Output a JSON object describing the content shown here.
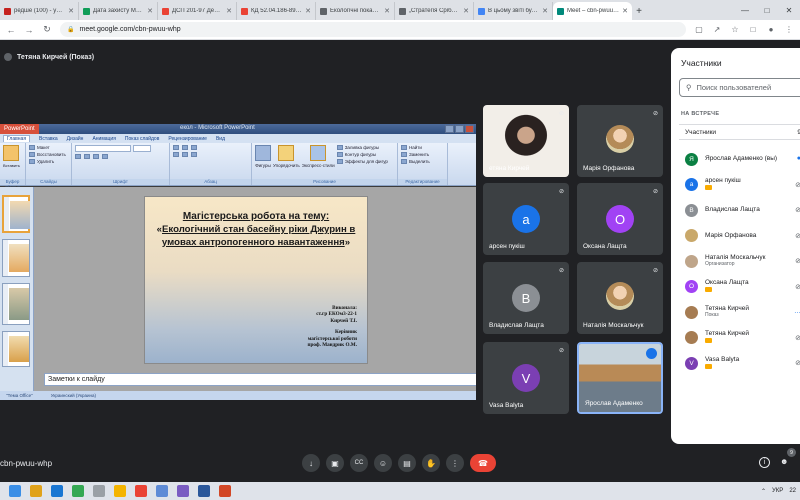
{
  "browser": {
    "tabs": [
      {
        "title": "редше (100) - yarad.Il",
        "color": "#c5221f",
        "active": false
      },
      {
        "title": "Дата захисту МР - Босг",
        "color": "#0f9d58",
        "active": false
      },
      {
        "title": "ДСП 201-97 Державні с",
        "color": "#ea4335",
        "active": false
      },
      {
        "title": "КД 52.04.186-89 Руково",
        "color": "#ea4335",
        "active": false
      },
      {
        "title": "Екологічні показники - И",
        "color": "#5f6368",
        "active": false
      },
      {
        "title": "„Стратегія Срібнянсько",
        "color": "#5f6368",
        "active": false
      },
      {
        "title": "В цьому звіті було проа",
        "color": "#4285f4",
        "active": false
      },
      {
        "title": "Meet – cbn-pwuu-whp",
        "color": "#00897b",
        "active": true
      }
    ],
    "new_tab": "+",
    "url": "meet.google.com/cbn-pwuu-whp"
  },
  "meet": {
    "presenter_label": "Тетяна Кирчей (Показ)",
    "meeting_code": "cbn-pwuu-whp",
    "people_count": "9"
  },
  "powerpoint": {
    "app_label": "PowerPoint",
    "doc_title": "екол - Microsoft PowerPoint",
    "tabs": [
      "Главная",
      "Вставка",
      "Дизайн",
      "Анимация",
      "Показ слайдов",
      "Рецензирование",
      "Вид"
    ],
    "ribbon": {
      "clipboard": {
        "paste": "Вставить",
        "label": "Буфер обмена"
      },
      "slides": {
        "create": "Создать слайд",
        "layout": "Макет",
        "restore": "Восстановить",
        "delete": "Удалить",
        "label": "Слайды"
      },
      "font": {
        "label": "Шрифт"
      },
      "paragraph": {
        "label": "Абзац"
      },
      "drawing": {
        "shapes": "Фигуры",
        "arrange": "Упорядочить",
        "styles": "Экспресс-стили",
        "fill": "Заливка фигуры",
        "outline": "Контур фигуры",
        "effects": "Эффекты для фигур",
        "label": "Рисование"
      },
      "editing": {
        "find": "Найти",
        "replace": "Заменить",
        "select": "Выделить",
        "label": "Редактирование"
      }
    },
    "slide": {
      "title": "Магістерська робота на тему:",
      "topic_open": "«",
      "topic": "Екологічний стан басейну ріки Джурин в умовах антропогенного навантаження",
      "topic_close": "»",
      "author_lines": [
        "Виконала:",
        "ст.гр ЕКОм3-22-1",
        "Кирчей Т.І."
      ],
      "supervisor_lines": [
        "Керівник",
        "магістерської роботи",
        "проф. Мандрик О.М."
      ]
    },
    "notes_placeholder": "Заметки к слайду",
    "status": {
      "theme": "\"Тема Office\"",
      "language": "Украинский (Украина)"
    }
  },
  "tiles": [
    {
      "name": "етяна Кирчей",
      "type": "camera",
      "muted": true
    },
    {
      "name": "Марія Орфанова",
      "type": "photo",
      "muted": true
    },
    {
      "name": "арсен пукіш",
      "type": "letter",
      "letter": "а",
      "color": "#1a73e8",
      "muted": true
    },
    {
      "name": "Оксана Лащта",
      "type": "letter",
      "letter": "О",
      "color": "#a142f4",
      "muted": true
    },
    {
      "name": "Владислав Лащта",
      "type": "letter",
      "letter": "В",
      "color": "#8b8f94",
      "muted": true
    },
    {
      "name": "Наталія Москальчук",
      "type": "photo",
      "muted": true
    },
    {
      "name": "Vasa Balyta",
      "type": "letter",
      "letter": "V",
      "color": "#7b3fb3",
      "muted": true
    },
    {
      "name": "Ярослав Адаменко",
      "type": "camera2",
      "muted": false
    }
  ],
  "panel": {
    "title": "Участники",
    "search_placeholder": "Поиск пользователей",
    "section": "НА ВСТРЕЧЕ",
    "sub": "Участники",
    "sub_count": "9",
    "people": [
      {
        "name": "Ярослав Адаменко (вы)",
        "sub": "",
        "letter": "Я",
        "color": "#0b8043",
        "badge": false,
        "status": "talking"
      },
      {
        "name": "арсен пукіш",
        "sub": "",
        "letter": "а",
        "color": "#1a73e8",
        "badge": true,
        "status": "muted"
      },
      {
        "name": "Владислав Лащта",
        "sub": "",
        "letter": "В",
        "color": "#8b8f94",
        "badge": false,
        "status": "muted"
      },
      {
        "name": "Марія Орфанова",
        "sub": "",
        "letter": "",
        "color": "#c9a86a",
        "badge": false,
        "status": "muted"
      },
      {
        "name": "Наталія Москальчук",
        "sub": "Организатор",
        "letter": "",
        "color": "#bfa58a",
        "badge": false,
        "status": "muted"
      },
      {
        "name": "Оксана Лащта",
        "sub": "",
        "letter": "О",
        "color": "#a142f4",
        "badge": true,
        "status": "muted"
      },
      {
        "name": "Тетяна Кирчей",
        "sub": "Показ",
        "letter": "",
        "color": "#a67c52",
        "badge": false,
        "status": "more"
      },
      {
        "name": "Тетяна Кирчей",
        "sub": "",
        "letter": "",
        "color": "#a67c52",
        "badge": true,
        "status": "muted"
      },
      {
        "name": "Vasa Balyta",
        "sub": "",
        "letter": "V",
        "color": "#7b3fb3",
        "badge": true,
        "status": "muted"
      }
    ]
  },
  "controls": {
    "icons": [
      "mic-icon",
      "camera-icon",
      "captions-icon",
      "emoji-icon",
      "present-icon",
      "raise-hand-icon",
      "more-icon"
    ],
    "end_call": "end-call-icon"
  },
  "taskbar": {
    "lang": "УКР",
    "time": "22"
  }
}
